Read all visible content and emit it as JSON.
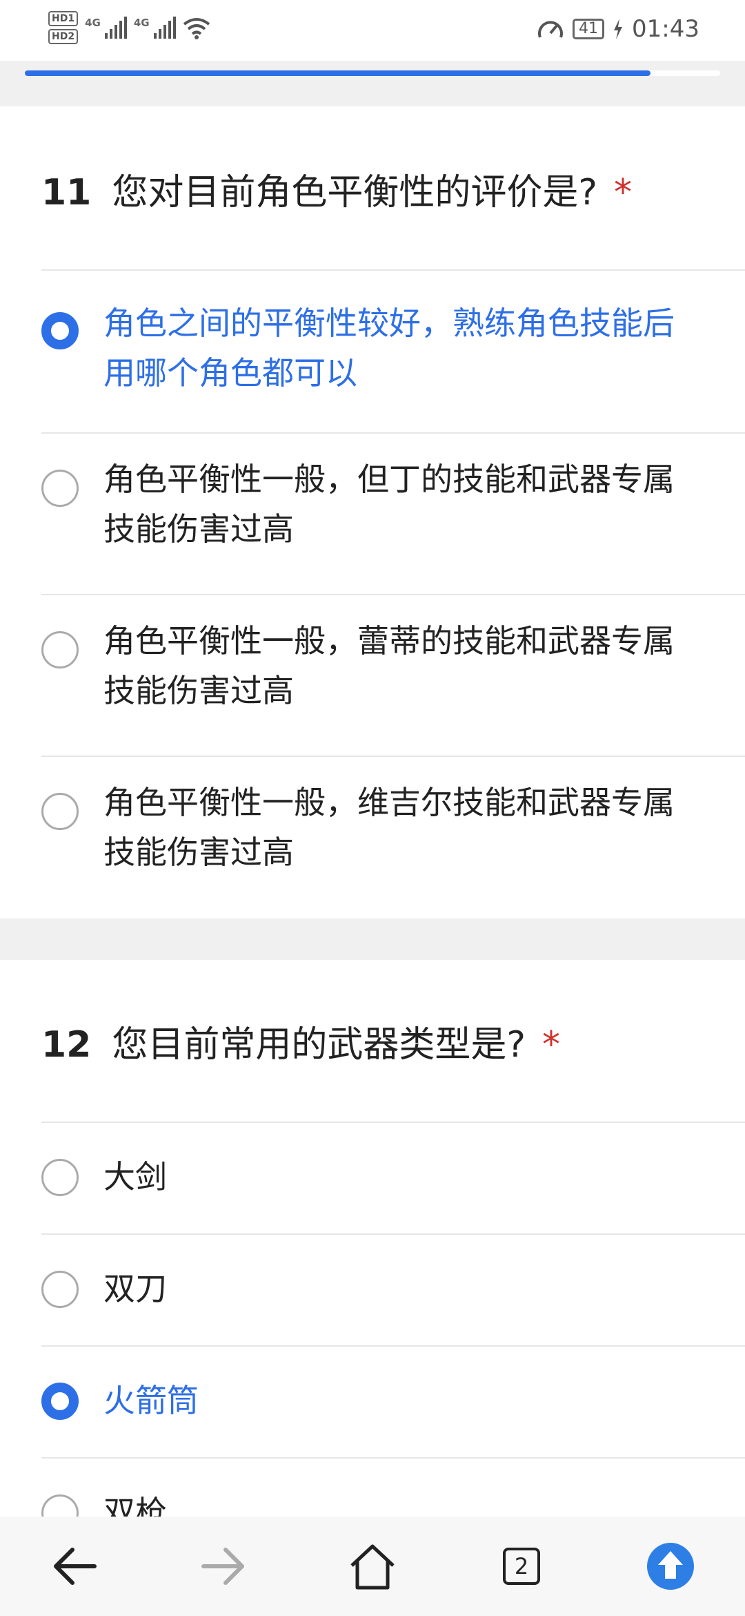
{
  "status": {
    "hd1": "HD1",
    "hd2": "HD2",
    "net1": "4G",
    "net2": "4G",
    "battery": "41",
    "time": "01:43"
  },
  "progress": {
    "fraction": 0.9
  },
  "questions": [
    {
      "number": "11",
      "text": "您对目前角色平衡性的评价是?",
      "required": "*",
      "options": [
        {
          "label": "角色之间的平衡性较好，熟练角色技能后用哪个角色都可以",
          "selected": true
        },
        {
          "label": "角色平衡性一般，但丁的技能和武器专属技能伤害过高",
          "selected": false
        },
        {
          "label": "角色平衡性一般，蕾蒂的技能和武器专属技能伤害过高",
          "selected": false
        },
        {
          "label": "角色平衡性一般，维吉尔技能和武器专属技能伤害过高",
          "selected": false
        }
      ]
    },
    {
      "number": "12",
      "text": "您目前常用的武器类型是?",
      "required": "*",
      "options": [
        {
          "label": "大剑",
          "selected": false
        },
        {
          "label": "双刀",
          "selected": false
        },
        {
          "label": "火箭筒",
          "selected": true
        },
        {
          "label": "双枪",
          "selected": false
        }
      ]
    }
  ],
  "nav": {
    "tabs_count": "2"
  },
  "colors": {
    "accent": "#2d6fe6",
    "required": "#d0312d",
    "gap": "#f0f0f0"
  }
}
